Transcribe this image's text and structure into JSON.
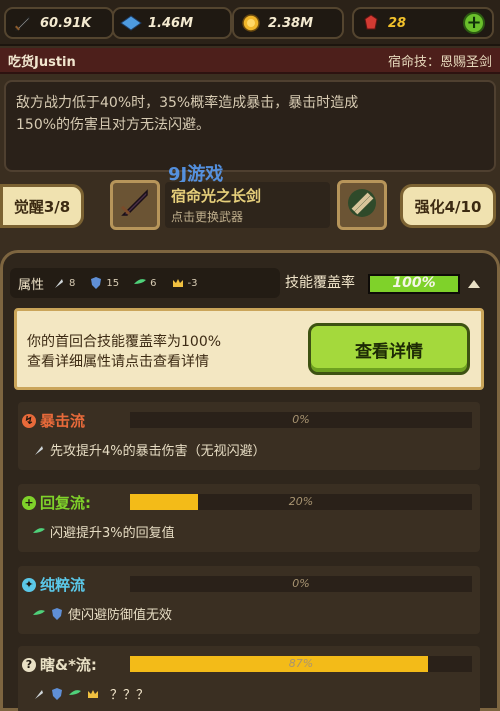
{
  "resources": {
    "power": "60.91K",
    "exp": "1.46M",
    "gold": "2.38M",
    "gems": "28"
  },
  "hero": {
    "name": "吃货Justin",
    "fate_skill": "宿命技：恩赐圣剑"
  },
  "description": {
    "line1": "敌方战力低于40%时，35%概率造成暴击，暴击时造成",
    "line2": "150%的伤害且对方无法闪避。"
  },
  "watermark": "9J游戏",
  "weapon": {
    "awaken_label": "觉醒3/8",
    "name": "宿命光之长剑",
    "sub": "点击更换武器",
    "enhance_label": "强化4/10"
  },
  "attributes": {
    "label": "属性",
    "values": [
      "8",
      "15",
      "6",
      "-3"
    ],
    "coverage_label": "技能覆盖率",
    "coverage_value": "100%",
    "coverage_fraction": 1.0
  },
  "notice": {
    "line1": "你的首回合技能覆盖率为100%",
    "line2": "查看详细属性请点击查看详情",
    "button": "查看详情"
  },
  "sections": [
    {
      "title": "暴击流",
      "pct": "0%",
      "fraction": 0.0,
      "desc": "先攻提升4%的暴击伤害（无视闪避）",
      "color": "#e86a3a"
    },
    {
      "title": "回复流:",
      "pct": "20%",
      "fraction": 0.2,
      "desc": "闪避提升3%的回复值",
      "color": "#7fd22a"
    },
    {
      "title": "纯粹流",
      "pct": "0%",
      "fraction": 0.0,
      "desc": "使闪避防御值无效",
      "color": "#5bc8e8"
    },
    {
      "title": "瞎&*流:",
      "pct": "87%",
      "fraction": 0.87,
      "desc": "？？？",
      "color": "#e9e0c5"
    }
  ]
}
